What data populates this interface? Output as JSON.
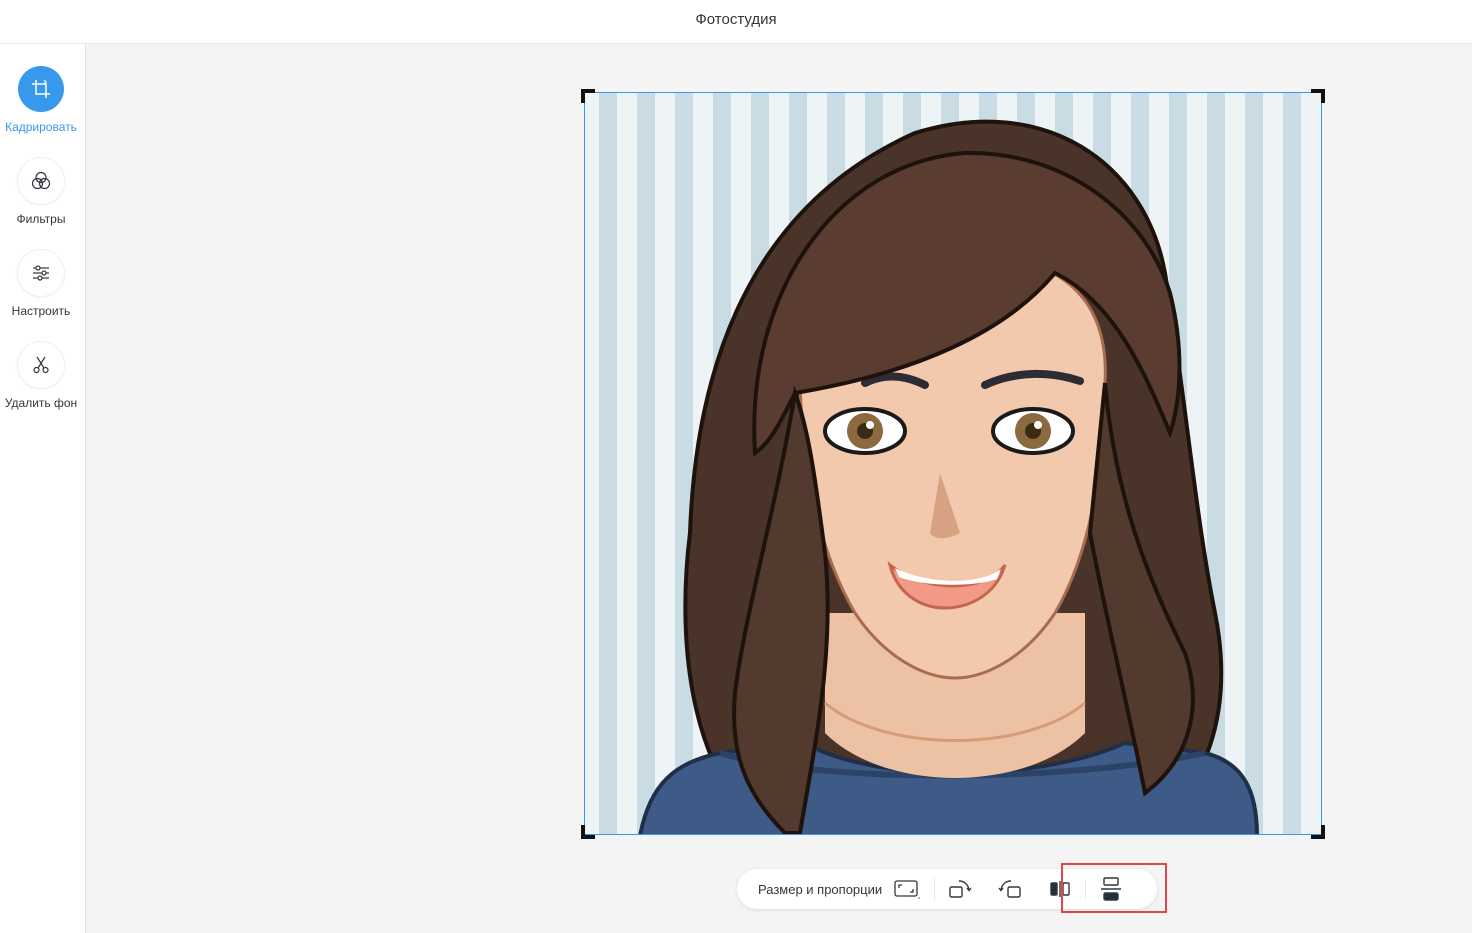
{
  "header": {
    "title": "Фотостудия"
  },
  "sidebar": {
    "tools": [
      {
        "label": "Кадрировать",
        "icon": "crop-icon",
        "active": true
      },
      {
        "label": "Фильтры",
        "icon": "filters-icon",
        "active": false
      },
      {
        "label": "Настроить",
        "icon": "adjust-sliders-icon",
        "active": false
      },
      {
        "label": "Удалить фон",
        "icon": "scissors-icon",
        "active": false
      }
    ]
  },
  "toolbar": {
    "size_label": "Размер и пропорции",
    "buttons": [
      "aspect-ratio-icon",
      "rotate-right-icon",
      "rotate-left-icon",
      "flip-horizontal-icon",
      "flip-vertical-icon"
    ]
  },
  "colors": {
    "accent": "#3899ec",
    "highlight": "#e0474c",
    "stripe": "#c9dce3"
  }
}
